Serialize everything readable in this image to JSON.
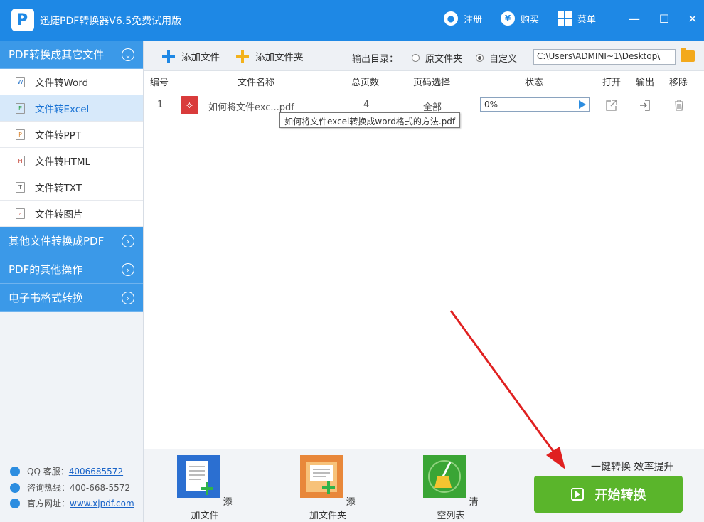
{
  "app": {
    "title": "迅捷PDF转换器V6.5免费试用版",
    "logo_letter": "P"
  },
  "titlebar": {
    "register_label": "注册",
    "buy_label": "购买",
    "menu_label": "菜单",
    "buy_glyph": "¥"
  },
  "window_controls": {
    "minimize": "—",
    "maximize": "☐",
    "close": "✕"
  },
  "sidebar": {
    "main_section": "PDF转换成其它文件",
    "items": [
      {
        "label": "文件转Word",
        "icon_letter": "W"
      },
      {
        "label": "文件转Excel",
        "icon_letter": "E"
      },
      {
        "label": "文件转PPT",
        "icon_letter": "P"
      },
      {
        "label": "文件转HTML",
        "icon_letter": "H"
      },
      {
        "label": "文件转TXT",
        "icon_letter": "T"
      },
      {
        "label": "文件转图片",
        "icon_letter": ""
      }
    ],
    "active_index": 1,
    "other_sections": [
      "其他文件转换成PDF",
      "PDF的其他操作",
      "电子书格式转换"
    ],
    "contact": {
      "qq_label": "QQ 客服：",
      "qq_value": "4006685572",
      "hotline_label": "咨询热线：",
      "hotline_value": "400-668-5572",
      "site_label": "官方网址：",
      "site_value": "www.xjpdf.com"
    }
  },
  "toolbar": {
    "add_file": "添加文件",
    "add_folder": "添加文件夹",
    "output_dir_label": "输出目录：",
    "option_original": "原文件夹",
    "option_custom": "自定义",
    "output_path": "C:\\Users\\ADMINI~1\\Desktop\\",
    "selected_option": "自定义"
  },
  "table": {
    "columns": [
      "编号",
      "文件名称",
      "总页数",
      "页码选择",
      "状态",
      "打开",
      "输出",
      "移除"
    ],
    "rows": [
      {
        "index": "1",
        "filename": "如何将文件exc...pdf",
        "pages": "4",
        "page_select": "全部",
        "status": "0%"
      }
    ],
    "tooltip": "如何将文件excel转换成word格式的方法.pdf"
  },
  "bottombar": {
    "add_file": "添加文件",
    "add_folder": "添加文件夹",
    "clear_list": "清空列表",
    "slogan": "一键转换  效率提升",
    "start_button": "开始转换"
  },
  "colors": {
    "brand_blue": "#1e88e5",
    "sidebar_header": "#3b99e8",
    "start_green": "#5ab52b",
    "annotation_red": "#e02020"
  }
}
